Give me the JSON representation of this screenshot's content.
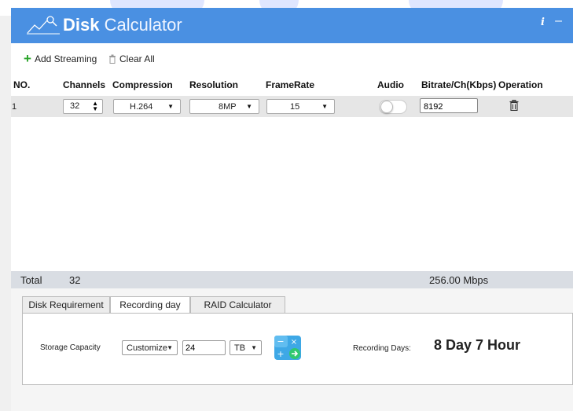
{
  "app": {
    "title_bold": "Disk",
    "title_light": "Calculator",
    "info_label": "i",
    "minimize_label": "–"
  },
  "toolbar": {
    "add_label": "Add Streaming",
    "clear_label": "Clear All"
  },
  "table": {
    "headers": [
      "NO.",
      "Channels",
      "Compression",
      "Resolution",
      "FrameRate",
      "Audio",
      "Bitrate/Ch(Kbps)",
      "Operation"
    ],
    "rows": [
      {
        "no": "1",
        "channels": "32",
        "compression": "H.264",
        "resolution": "8MP",
        "framerate": "15",
        "audio_on": false,
        "bitrate": "8192"
      }
    ]
  },
  "total": {
    "label": "Total",
    "count": "32",
    "rate": "256.00 Mbps"
  },
  "tabs": [
    "Disk Requirement",
    "Recording day",
    "RAID Calculator"
  ],
  "active_tab": "Recording day",
  "recording": {
    "storage_label": "Storage Capacity",
    "mode": "Customize",
    "capacity": "24",
    "unit": "TB",
    "days_label": "Recording Days:",
    "days_value": "8 Day 7 Hour"
  },
  "colors": {
    "header": "#4a90e2",
    "accent_green": "#2ba52b"
  }
}
